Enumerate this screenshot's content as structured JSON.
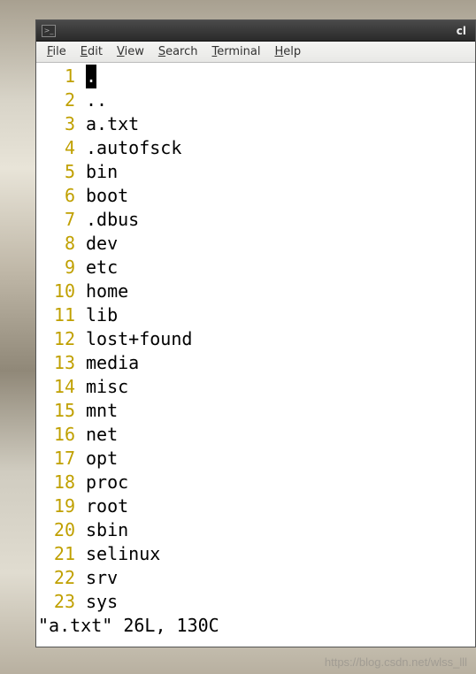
{
  "titlebar": {
    "icon_glyph": ">_",
    "title_fragment": "cl"
  },
  "menubar": {
    "items": [
      {
        "underline": "F",
        "rest": "ile"
      },
      {
        "underline": "E",
        "rest": "dit"
      },
      {
        "underline": "V",
        "rest": "iew"
      },
      {
        "underline": "S",
        "rest": "earch"
      },
      {
        "underline": "T",
        "rest": "erminal"
      },
      {
        "underline": "H",
        "rest": "elp"
      }
    ]
  },
  "editor": {
    "lines": [
      {
        "num": "1",
        "text": ".",
        "cursor": true
      },
      {
        "num": "2",
        "text": ".."
      },
      {
        "num": "3",
        "text": "a.txt"
      },
      {
        "num": "4",
        "text": ".autofsck"
      },
      {
        "num": "5",
        "text": "bin"
      },
      {
        "num": "6",
        "text": "boot"
      },
      {
        "num": "7",
        "text": ".dbus"
      },
      {
        "num": "8",
        "text": "dev"
      },
      {
        "num": "9",
        "text": "etc"
      },
      {
        "num": "10",
        "text": "home"
      },
      {
        "num": "11",
        "text": "lib"
      },
      {
        "num": "12",
        "text": "lost+found"
      },
      {
        "num": "13",
        "text": "media"
      },
      {
        "num": "14",
        "text": "misc"
      },
      {
        "num": "15",
        "text": "mnt"
      },
      {
        "num": "16",
        "text": "net"
      },
      {
        "num": "17",
        "text": "opt"
      },
      {
        "num": "18",
        "text": "proc"
      },
      {
        "num": "19",
        "text": "root"
      },
      {
        "num": "20",
        "text": "sbin"
      },
      {
        "num": "21",
        "text": "selinux"
      },
      {
        "num": "22",
        "text": "srv"
      },
      {
        "num": "23",
        "text": "sys"
      }
    ],
    "status": "\"a.txt\" 26L, 130C"
  },
  "watermark": "https://blog.csdn.net/wlss_lll"
}
